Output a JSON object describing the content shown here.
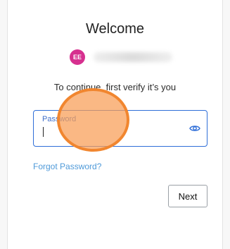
{
  "header": {
    "title": "Welcome"
  },
  "account": {
    "avatar_initials": "EE"
  },
  "prompt": {
    "text": "To continue, first verify it’s you"
  },
  "password_field": {
    "label": "Password",
    "value": "",
    "visibility_icon": "eye-icon"
  },
  "links": {
    "forgot_password": "Forgot Password?"
  },
  "buttons": {
    "next": "Next"
  },
  "colors": {
    "accent": "#2f6ed8",
    "link": "#4f9ad9",
    "avatar": "#d6308f",
    "touch_indicator": "#f89c54"
  }
}
